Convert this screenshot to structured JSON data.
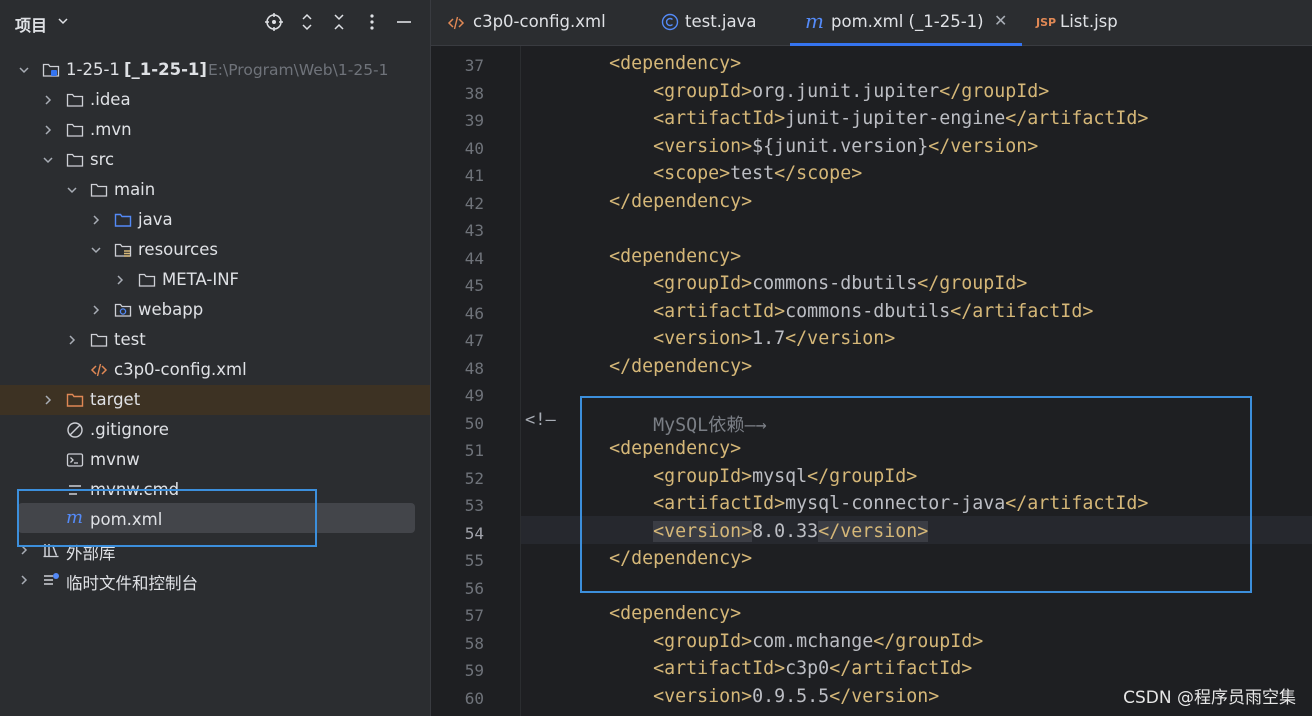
{
  "panel": {
    "title": "项目",
    "header_icons": [
      "crosshair-icon",
      "expand-collapse-icon",
      "collapse-all-icon",
      "more-icon",
      "minimize-icon"
    ]
  },
  "tree": [
    {
      "label": "1-25-1",
      "bold_suffix": "[_1-25-1]",
      "hint": "E:\\Program\\Web\\1-25-1",
      "icon": "module-folder-icon",
      "expanded": true
    },
    {
      "label": ".idea",
      "icon": "folder-icon",
      "expanded": false
    },
    {
      "label": ".mvn",
      "icon": "folder-icon",
      "expanded": false
    },
    {
      "label": "src",
      "icon": "folder-icon",
      "expanded": true
    },
    {
      "label": "main",
      "icon": "folder-icon",
      "expanded": true
    },
    {
      "label": "java",
      "icon": "source-folder-icon",
      "expanded": false
    },
    {
      "label": "resources",
      "icon": "resources-folder-icon",
      "expanded": true
    },
    {
      "label": "META-INF",
      "icon": "folder-icon",
      "expanded": false
    },
    {
      "label": "webapp",
      "icon": "web-folder-icon",
      "expanded": false
    },
    {
      "label": "test",
      "icon": "folder-icon",
      "expanded": false
    },
    {
      "label": "c3p0-config.xml",
      "icon": "xml-file-icon"
    },
    {
      "label": "target",
      "icon": "excluded-folder-icon",
      "expanded": false
    },
    {
      "label": ".gitignore",
      "icon": "ignore-file-icon"
    },
    {
      "label": "mvnw",
      "icon": "shell-file-icon"
    },
    {
      "label": "mvnw.cmd",
      "icon": "text-file-icon"
    },
    {
      "label": "pom.xml",
      "icon": "maven-file-icon"
    },
    {
      "label": "外部库",
      "icon": "library-icon",
      "expanded": false
    },
    {
      "label": "临时文件和控制台",
      "icon": "scratches-icon",
      "expanded": false
    }
  ],
  "tabs": [
    {
      "label": "c3p0-config.xml",
      "icon": "xml-file-icon",
      "active": false
    },
    {
      "label": "test.java",
      "icon": "java-class-icon",
      "active": false
    },
    {
      "label": "pom.xml (_1-25-1)",
      "icon": "maven-file-icon",
      "active": true
    },
    {
      "label": "List.jsp",
      "icon": "jsp-file-icon",
      "active": false
    }
  ],
  "editor": {
    "current_line": "54",
    "fold_marker": "<!—",
    "lines": [
      {
        "n": "37",
        "text": "        <dependency>"
      },
      {
        "n": "38",
        "text": "            <groupId>org.junit.jupiter</groupId>"
      },
      {
        "n": "39",
        "text": "            <artifactId>junit-jupiter-engine</artifactId>"
      },
      {
        "n": "40",
        "text": "            <version>${junit.version}</version>"
      },
      {
        "n": "41",
        "text": "            <scope>test</scope>"
      },
      {
        "n": "42",
        "text": "        </dependency>"
      },
      {
        "n": "43",
        "text": ""
      },
      {
        "n": "44",
        "text": "        <dependency>"
      },
      {
        "n": "45",
        "text": "            <groupId>commons-dbutils</groupId>"
      },
      {
        "n": "46",
        "text": "            <artifactId>commons-dbutils</artifactId>"
      },
      {
        "n": "47",
        "text": "            <version>1.7</version>"
      },
      {
        "n": "48",
        "text": "        </dependency>"
      },
      {
        "n": "49",
        "text": ""
      },
      {
        "n": "50",
        "text": "            MySQL依赖—→"
      },
      {
        "n": "51",
        "text": "        <dependency>"
      },
      {
        "n": "52",
        "text": "            <groupId>mysql</groupId>"
      },
      {
        "n": "53",
        "text": "            <artifactId>mysql-connector-java</artifactId>"
      },
      {
        "n": "54",
        "text": "            <version>8.0.33</version>"
      },
      {
        "n": "55",
        "text": "        </dependency>"
      },
      {
        "n": "56",
        "text": ""
      },
      {
        "n": "57",
        "text": "        <dependency>"
      },
      {
        "n": "58",
        "text": "            <groupId>com.mchange</groupId>"
      },
      {
        "n": "59",
        "text": "            <artifactId>c3p0</artifactId>"
      },
      {
        "n": "60",
        "text": "            <version>0.9.5.5</version>"
      }
    ]
  },
  "watermark": "CSDN @程序员雨空集",
  "colors": {
    "accent": "#3574f0",
    "annotation_box": "#3c8fdc",
    "xml_tag": "#d5b778",
    "comment": "#7a7e85"
  }
}
